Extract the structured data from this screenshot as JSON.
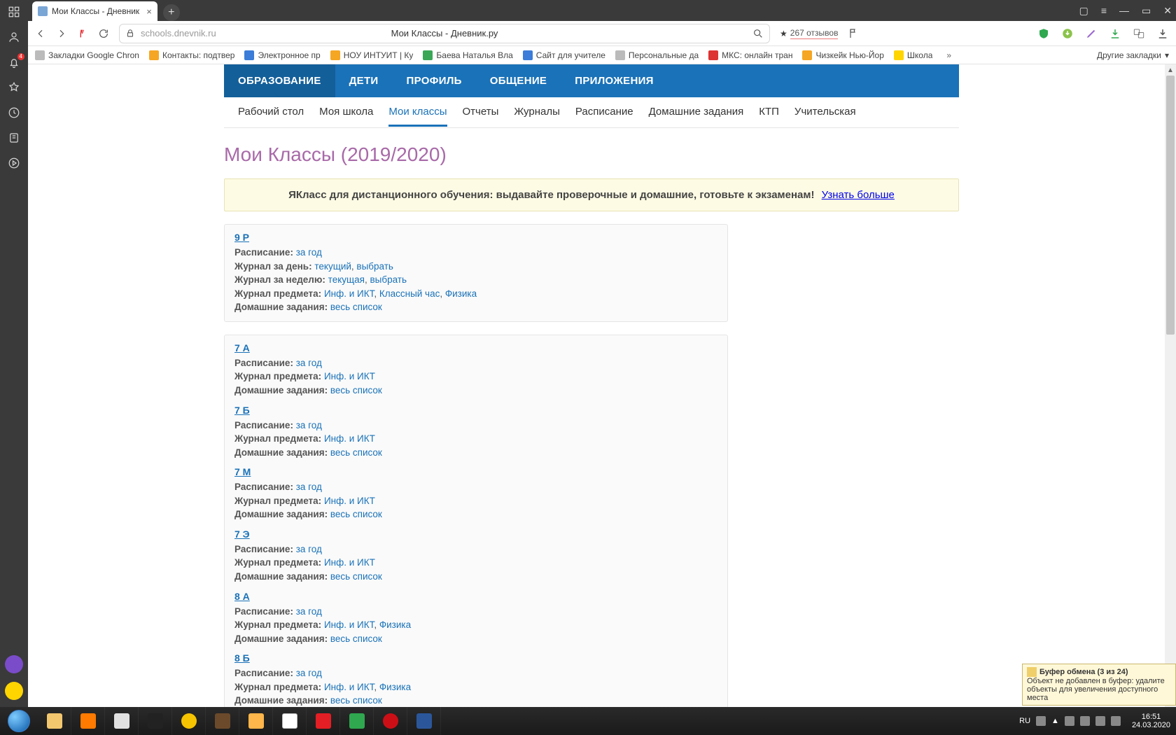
{
  "browser": {
    "tab_title": "Мои Классы - Дневник",
    "url": "schools.dnevnik.ru",
    "center_title": "Мои Классы - Дневник.ру",
    "reviews": "267 отзывов",
    "bookmarks": [
      {
        "label": "Закладки Google Chron",
        "cls": ""
      },
      {
        "label": "Контакты: подтвер",
        "cls": "orange"
      },
      {
        "label": "Электронное пр",
        "cls": "blue"
      },
      {
        "label": "НОУ ИНТУИТ | Ку",
        "cls": "orange"
      },
      {
        "label": "Баева Наталья Вла",
        "cls": "green"
      },
      {
        "label": "Сайт для учителе",
        "cls": "blue"
      },
      {
        "label": "Персональные да",
        "cls": ""
      },
      {
        "label": "МКС: онлайн тран",
        "cls": "red"
      },
      {
        "label": "Чизкейк Нью-Йор",
        "cls": "orange"
      },
      {
        "label": "Школа",
        "cls": "yellow"
      }
    ],
    "other_bookmarks": "Другие закладки",
    "sidebar_badge": "4"
  },
  "nav_main": [
    "ОБРАЗОВАНИЕ",
    "ДЕТИ",
    "ПРОФИЛЬ",
    "ОБЩЕНИЕ",
    "ПРИЛОЖЕНИЯ"
  ],
  "nav_main_active": 0,
  "subnav": [
    "Рабочий стол",
    "Моя школа",
    "Мои классы",
    "Отчеты",
    "Журналы",
    "Расписание",
    "Домашние задания",
    "КТП",
    "Учительская"
  ],
  "subnav_active": 2,
  "page_title": "Мои Классы (2019/2020)",
  "notice_text": "ЯКласс для дистанционного обучения: выдавайте проверочные и домашние, готовьте к экзаменам!",
  "notice_link": "Узнать больше",
  "labels": {
    "schedule": "Расписание:",
    "journal_day": "Журнал за день:",
    "journal_week": "Журнал за неделю:",
    "journal_subject": "Журнал предмета:",
    "homework": "Домашние задания:"
  },
  "links": {
    "year": "за год",
    "current_m": "текущий",
    "current_f": "текущая",
    "choose": "выбрать",
    "full_list": "весь список"
  },
  "card1": {
    "title": "9 Р",
    "subjects": [
      "Инф. и ИКТ",
      "Классный час",
      "Физика"
    ]
  },
  "card2": [
    {
      "title": "7 А",
      "subjects": [
        "Инф. и ИКТ"
      ]
    },
    {
      "title": "7 Б",
      "subjects": [
        "Инф. и ИКТ"
      ]
    },
    {
      "title": "7 М",
      "subjects": [
        "Инф. и ИКТ"
      ]
    },
    {
      "title": "7 Э",
      "subjects": [
        "Инф. и ИКТ"
      ]
    },
    {
      "title": "8 А",
      "subjects": [
        "Инф. и ИКТ",
        "Физика"
      ]
    },
    {
      "title": "8 Б",
      "subjects": [
        "Инф. и ИКТ",
        "Физика"
      ]
    }
  ],
  "clipboard": {
    "title": "Буфер обмена (3 из 24)",
    "body": "Объект не добавлен в буфер: удалите объекты для увеличения доступного места"
  },
  "tray": {
    "lang": "RU",
    "time": "16:51",
    "date": "24.03.2020"
  }
}
